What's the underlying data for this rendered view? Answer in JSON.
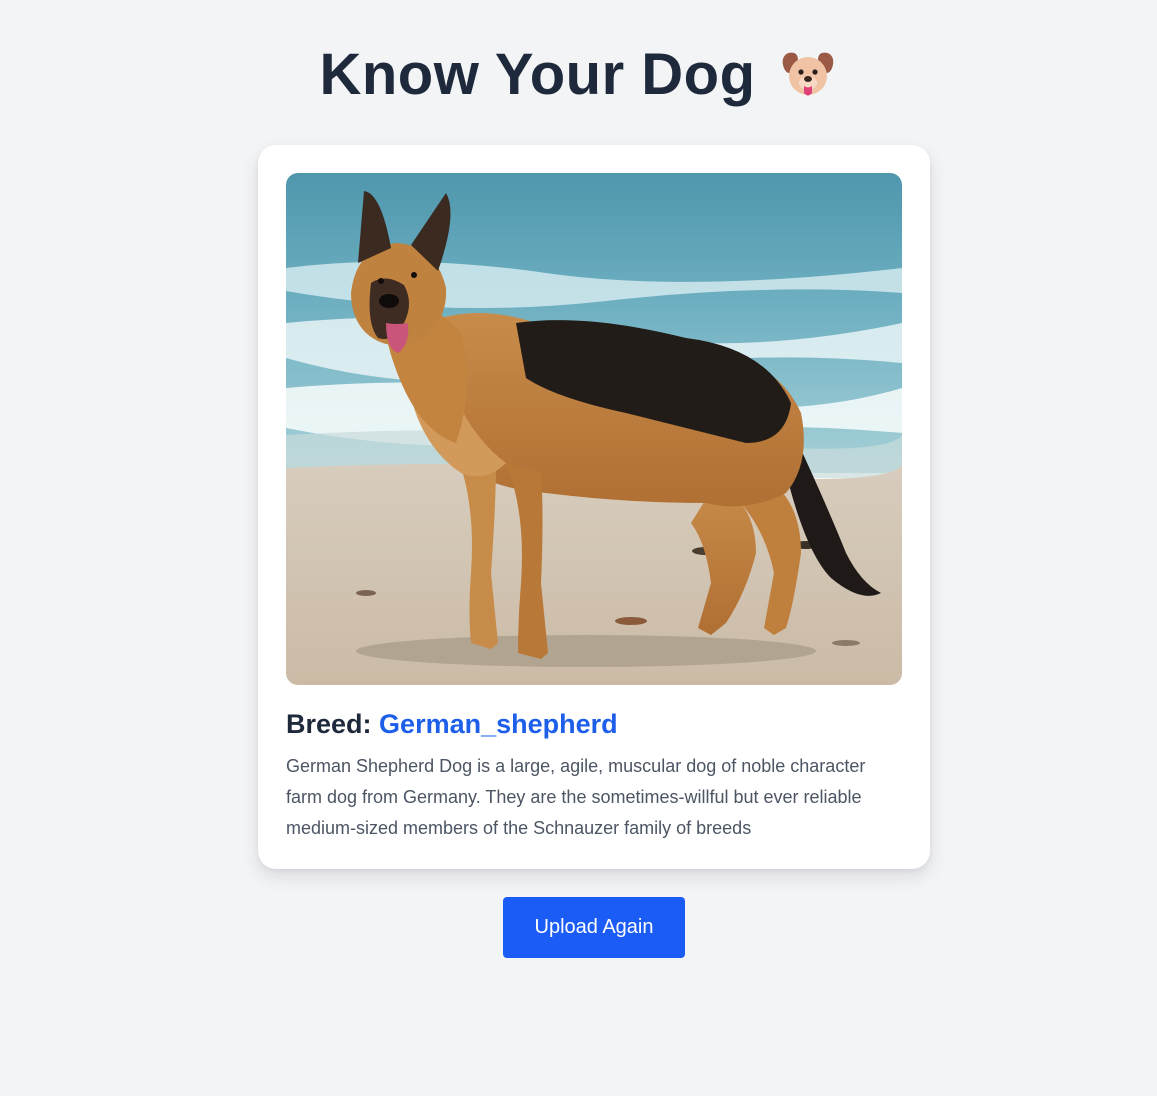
{
  "header": {
    "title": "Know Your Dog",
    "title_icon": "dog-face-icon"
  },
  "result": {
    "image_subject": "German Shepherd dog standing on a beach",
    "breed_label": "Breed:",
    "breed_value": "German_shepherd",
    "description": "German Shepherd Dog is a large, agile, muscular dog of noble character farm dog from Germany. They are the sometimes-willful but ever reliable medium-sized members of the Schnauzer family of breeds"
  },
  "actions": {
    "upload_again_label": "Upload Again"
  },
  "colors": {
    "background": "#f3f4f6",
    "title": "#1e293b",
    "accent": "#1a5cf5",
    "breed_value": "#1d5fea",
    "description_text": "#4b5563"
  }
}
